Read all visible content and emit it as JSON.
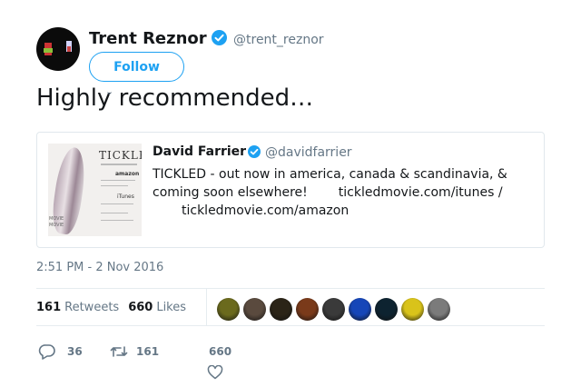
{
  "tweet": {
    "author_name": "Trent Reznor",
    "author_handle": "@trent_reznor",
    "follow_label": "Follow",
    "text": "Highly recommended…",
    "timestamp": "2:51 PM - 2 Nov 2016"
  },
  "quoted": {
    "author_name": "David Farrier",
    "author_handle": "@davidfarrier",
    "text_part1": "TICKLED - out now in america, canada & scandinavia, & coming soon elsewhere!",
    "link1": "tickledmovie.com/itunes /",
    "link2": "tickledmovie.com/amazon",
    "poster": {
      "title": "TICKLE",
      "amazon": "amazon",
      "itunes": "iTunes",
      "movie_lines": [
        "MOVIE",
        "MOVIE"
      ]
    }
  },
  "stats": {
    "retweets_count": "161",
    "retweets_label": "Retweets",
    "likes_count": "660",
    "likes_label": "Likes"
  },
  "likers": [
    {
      "icon": "avatar-1",
      "color": "#6b6a1d"
    },
    {
      "icon": "avatar-2",
      "color": "#5a4a3e"
    },
    {
      "icon": "avatar-3",
      "color": "#2b2417"
    },
    {
      "icon": "avatar-4",
      "color": "#7a3a1a"
    },
    {
      "icon": "avatar-5",
      "color": "#3a3a3a"
    },
    {
      "icon": "avatar-6",
      "color": "#1646b8"
    },
    {
      "icon": "avatar-7",
      "color": "#0d2330"
    },
    {
      "icon": "avatar-8",
      "color": "#d9c31a"
    },
    {
      "icon": "avatar-9",
      "color": "#7b7b7b"
    }
  ],
  "actions": {
    "reply_count": "36",
    "retweet_count": "161",
    "like_count": "660"
  },
  "colors": {
    "accent": "#1da1f2",
    "muted": "#657786",
    "text": "#14171a",
    "border": "#e1e8ed"
  }
}
